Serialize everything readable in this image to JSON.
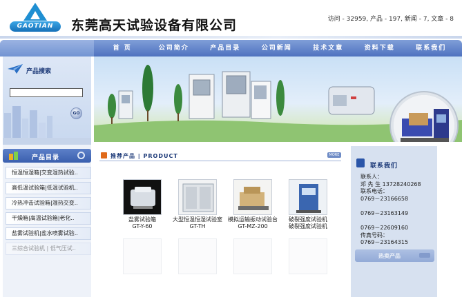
{
  "header": {
    "logo_text": "GAOTIAN",
    "company_name": "东莞高天试验设备有限公司",
    "stats": "访问 - 32959, 产品 - 197, 新闻 - 7, 文章 - 8"
  },
  "nav": {
    "items": [
      {
        "label": "首 页"
      },
      {
        "label": "公司简介"
      },
      {
        "label": "产品目录"
      },
      {
        "label": "公司新闻"
      },
      {
        "label": "技术文章"
      },
      {
        "label": "资料下载"
      },
      {
        "label": "联系我们"
      }
    ]
  },
  "search": {
    "title": "产品搜索",
    "input_value": "",
    "go_label": "GO"
  },
  "catalog": {
    "title": "产品目录",
    "items": [
      {
        "label": "恒温恒湿箱|交变湿热试验.."
      },
      {
        "label": "高低温试验箱|低温试验机.."
      },
      {
        "label": "冷热冲击试验箱|湿热交变.."
      },
      {
        "label": "干燥箱|高温试验箱|老化.."
      },
      {
        "label": "盐雾试验机|盐水喷雾试验.."
      },
      {
        "label": "三综合试验机 | 低气压试.."
      }
    ]
  },
  "products_section": {
    "title": "推荐产品 | PRODUCT",
    "more_label": "MORE",
    "items": [
      {
        "name": "盐雾试验箱",
        "code": "GT-Y-60"
      },
      {
        "name": "大型恒温恒湿试验室",
        "code": "GT-TH"
      },
      {
        "name": "模拟运输振动试验台",
        "code": "GT-MZ-200"
      },
      {
        "name": "破裂强度试验机",
        "code": "破裂强度试验机"
      }
    ]
  },
  "contact": {
    "title": "联系我们",
    "lines": [
      "联系人：",
      "邓 先 生   13728240268",
      "联系电话：",
      "0769－23166658",
      "",
      "0769－23163149",
      "",
      "0769－22609160",
      "传真号码：",
      "0769－23164315"
    ],
    "hot_title": "热卖产品"
  },
  "colors": {
    "nav": "#5a7cc4",
    "accent": "#1f8fd2",
    "sidebar": "#dde7f6"
  }
}
